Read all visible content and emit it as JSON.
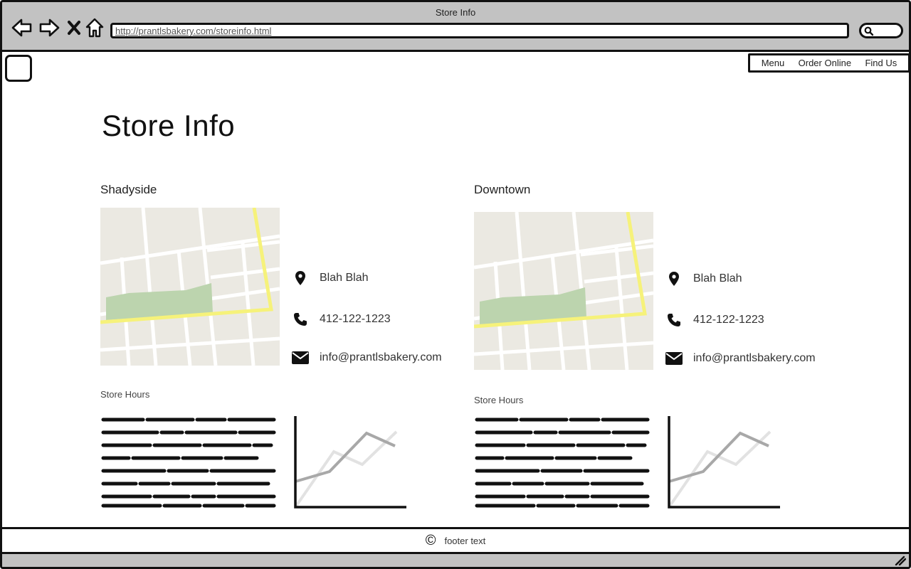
{
  "window": {
    "title": "Store Info",
    "url": "http://prantlsbakery.com/storeinfo.html"
  },
  "nav": {
    "items": [
      {
        "label": "Menu"
      },
      {
        "label": "Order Online"
      },
      {
        "label": "Find Us"
      }
    ]
  },
  "page": {
    "title": "Store Info"
  },
  "locations": [
    {
      "name": "Shadyside",
      "address": "Blah Blah",
      "phone": "412-122-1223",
      "email": "info@prantlsbakery.com",
      "hours_label": "Store Hours"
    },
    {
      "name": "Downtown",
      "address": "Blah Blah",
      "phone": "412-122-1223",
      "email": "info@prantlsbakery.com",
      "hours_label": "Store Hours"
    }
  ],
  "footer": {
    "copyright_symbol": "©",
    "text": "footer text"
  },
  "icons": {
    "back": "back-arrow-icon",
    "forward": "forward-arrow-icon",
    "stop": "close-icon",
    "home": "home-icon",
    "search": "search-icon",
    "location": "map-pin-icon",
    "phone": "phone-icon",
    "email": "envelope-icon"
  },
  "colors": {
    "chrome": "#c2c2c2",
    "map_bg": "#ebe9e2",
    "map_park": "#bcd4ae",
    "map_highway": "#f6f27a"
  }
}
